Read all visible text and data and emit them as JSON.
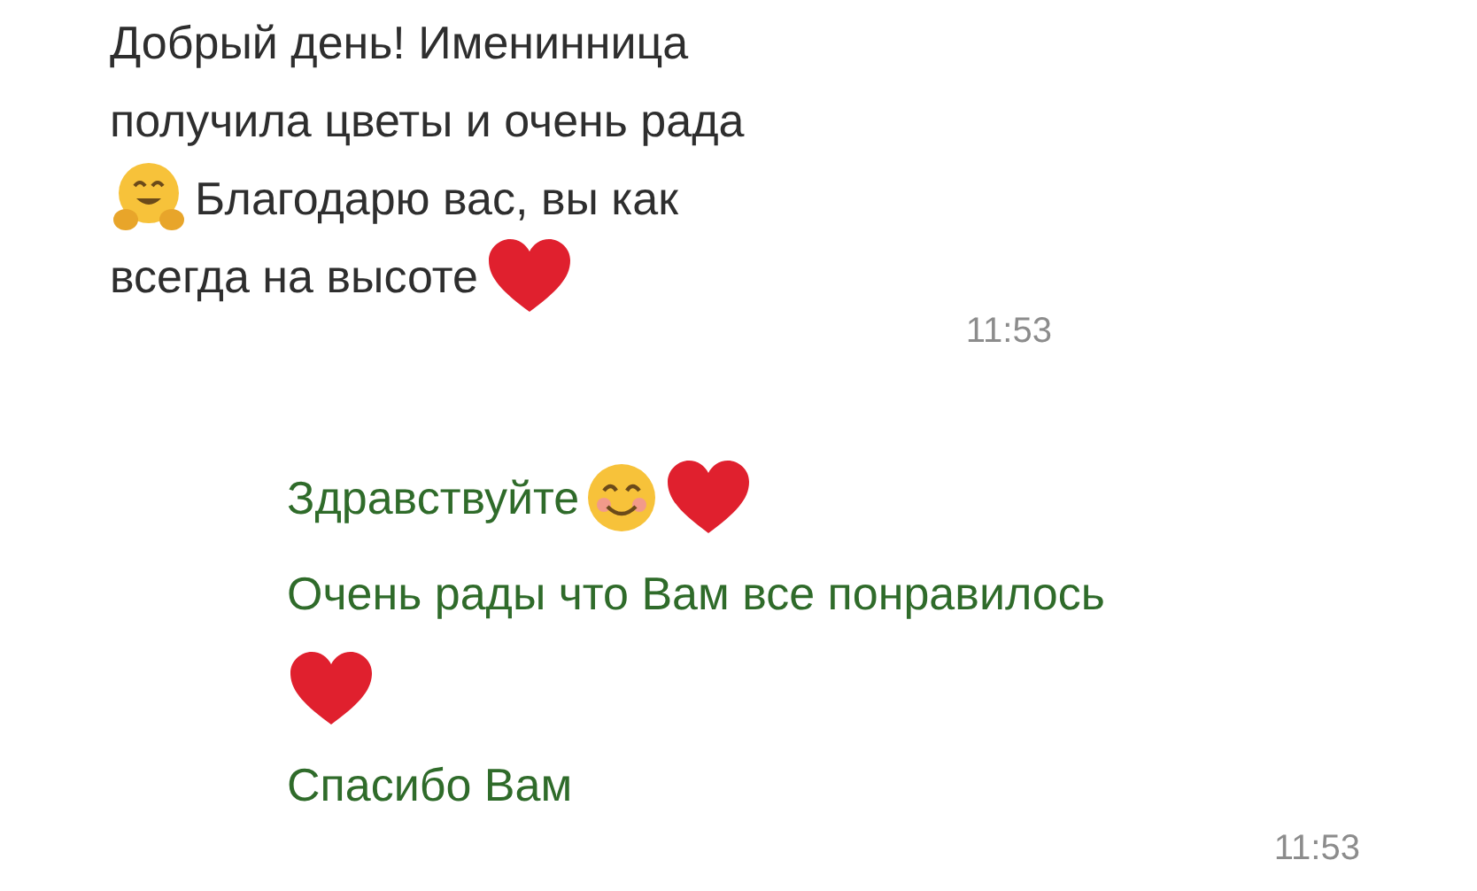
{
  "messages": [
    {
      "kind": "incoming",
      "time": "11:53",
      "lines": [
        [
          {
            "kind": "text",
            "text": "Добрый день! Именинница"
          }
        ],
        [
          {
            "kind": "text",
            "text": "получила цветы и очень рада"
          }
        ],
        [
          {
            "kind": "hug"
          },
          {
            "kind": "text",
            "text": "Благодарю вас, вы как"
          }
        ],
        [
          {
            "kind": "text",
            "text": "всегда на высоте"
          },
          {
            "kind": "heart"
          }
        ]
      ]
    },
    {
      "kind": "outgoing",
      "time": "11:53",
      "lines": [
        [
          {
            "kind": "text",
            "text": "Здравствуйте"
          },
          {
            "kind": "smile"
          },
          {
            "kind": "heart"
          }
        ],
        [
          {
            "kind": "text",
            "text": "Очень рады что Вам все понравилось"
          }
        ],
        [
          {
            "kind": "heart"
          }
        ],
        [
          {
            "kind": "text",
            "text": "Спасибо Вам"
          }
        ]
      ]
    }
  ]
}
